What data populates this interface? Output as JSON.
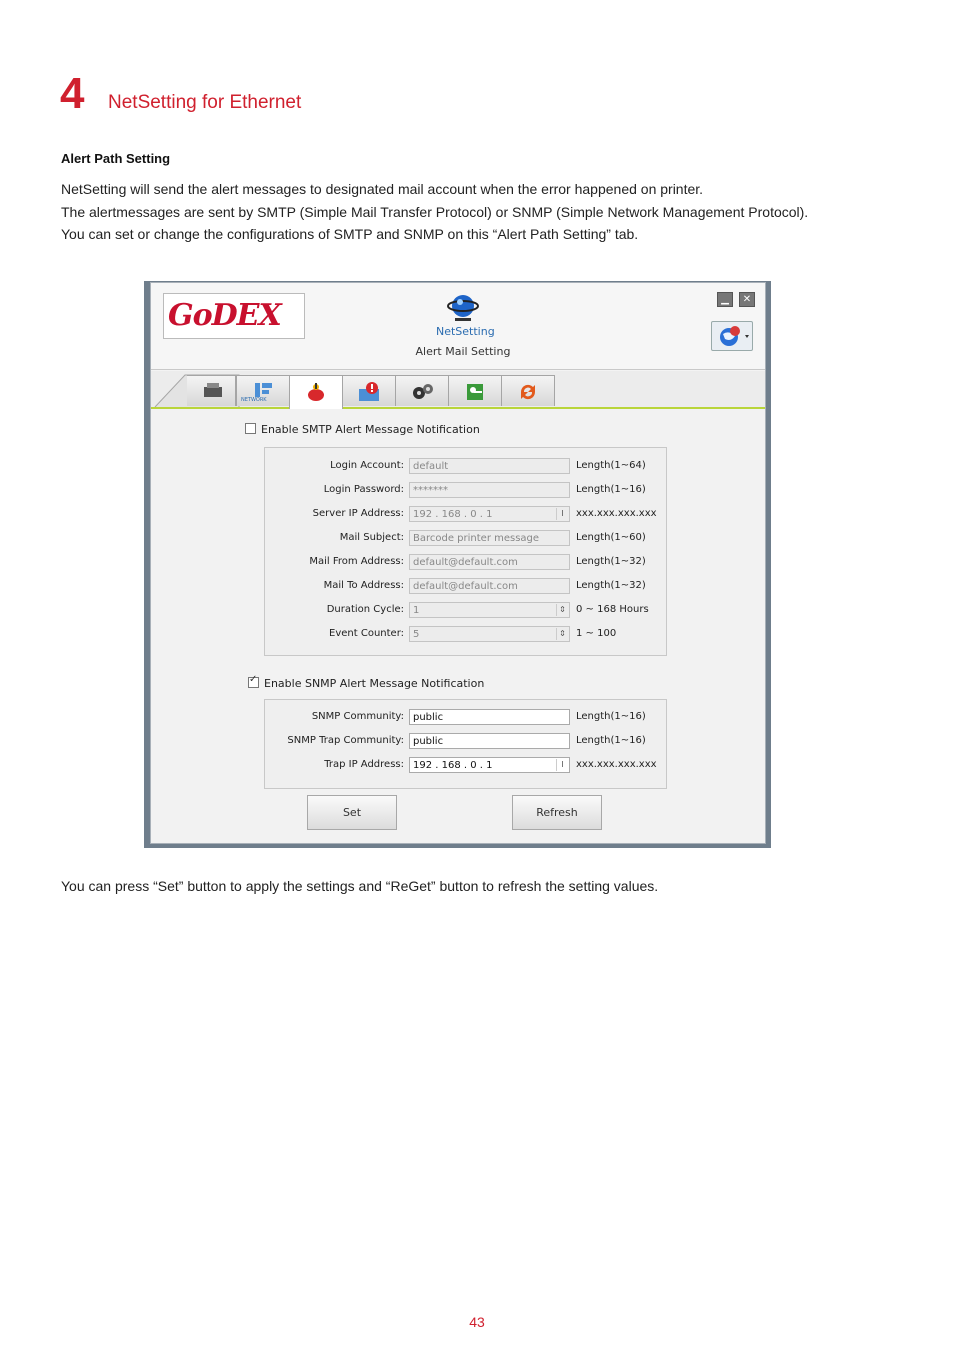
{
  "doc": {
    "chapter_number": "4",
    "chapter_title": "NetSetting for Ethernet",
    "section_title": "Alert Path Setting",
    "paragraphs": [
      "NetSetting will send the alert messages to designated mail account when the error happened on printer.",
      "The alertmessages are sent by SMTP (Simple Mail Transfer Protocol) or SNMP (Simple Network Management Protocol).",
      "You can set or change the configurations of SMTP and SNMP on this “Alert Path Setting” tab."
    ],
    "footnote": "You can press “Set” button to apply the settings and “ReGet” button to refresh the setting values.",
    "page_number": "43"
  },
  "app": {
    "logo": "GoDEX",
    "name": "NetSetting",
    "subtitle": "Alert Mail Setting",
    "tab_network_label": "NETWORK",
    "colors": {
      "brand_red": "#c8102e",
      "accent_green": "#b9d53a"
    },
    "smtp": {
      "enable_label": "Enable SMTP Alert Message Notification",
      "enabled": false,
      "fields": [
        {
          "label": "Login Account:",
          "value": "default",
          "hint": "Length(1~64)"
        },
        {
          "label": "Login Password:",
          "value": "*******",
          "hint": "Length(1~16)"
        },
        {
          "label": "Server IP Address:",
          "value": "192  .  168  .  0  .  1",
          "hint": "xxx.xxx.xxx.xxx"
        },
        {
          "label": "Mail Subject:",
          "value": "Barcode printer message",
          "hint": "Length(1~60)"
        },
        {
          "label": "Mail From Address:",
          "value": "default@default.com",
          "hint": "Length(1~32)"
        },
        {
          "label": "Mail To Address:",
          "value": "default@default.com",
          "hint": "Length(1~32)"
        },
        {
          "label": "Duration Cycle:",
          "value": "1",
          "hint": "0 ~ 168 Hours"
        },
        {
          "label": "Event Counter:",
          "value": "5",
          "hint": "1 ~ 100"
        }
      ]
    },
    "snmp": {
      "enable_label": "Enable SNMP Alert Message Notification",
      "enabled": true,
      "fields": [
        {
          "label": "SNMP Community:",
          "value": "public",
          "hint": "Length(1~16)"
        },
        {
          "label": "SNMP Trap Community:",
          "value": "public",
          "hint": "Length(1~16)"
        },
        {
          "label": "Trap IP Address:",
          "value": "192  .  168  .  0  .  1",
          "hint": "xxx.xxx.xxx.xxx"
        }
      ]
    },
    "buttons": {
      "set": "Set",
      "refresh": "Refresh"
    }
  }
}
